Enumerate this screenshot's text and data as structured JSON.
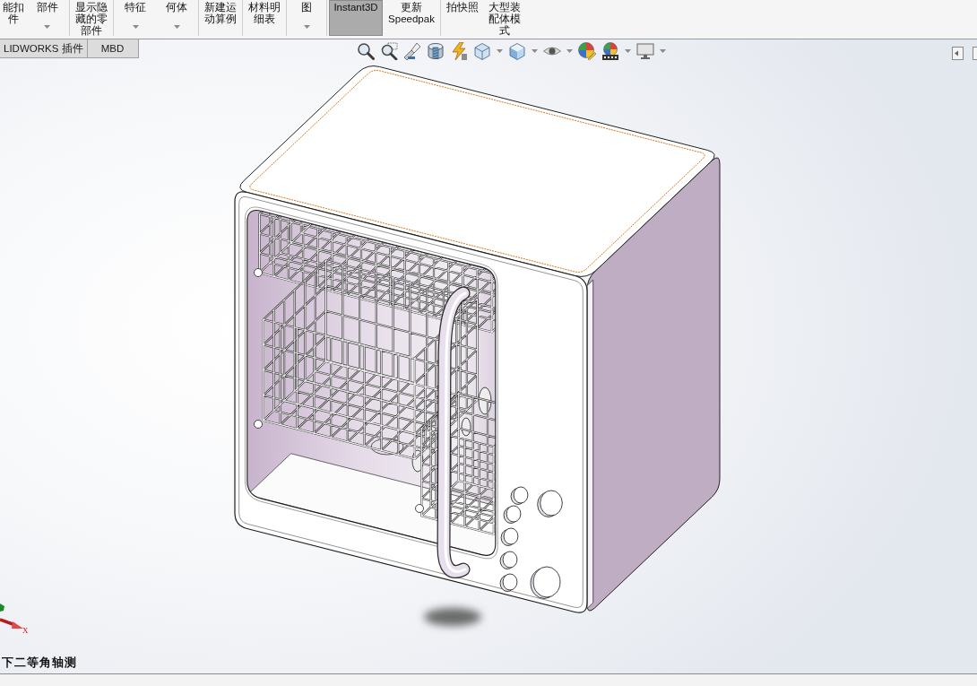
{
  "ribbon": {
    "groups": [
      {
        "buttons": [
          {
            "lines": [
              "能扣",
              "件"
            ],
            "dropdown": false,
            "on": false
          },
          {
            "lines": [
              "部件"
            ],
            "dropdown": true,
            "on": false
          }
        ]
      },
      {
        "buttons": [
          {
            "lines": [
              "显示隐",
              "藏的零",
              "部件"
            ],
            "dropdown": false,
            "on": false
          }
        ]
      },
      {
        "buttons": [
          {
            "lines": [
              "特征"
            ],
            "dropdown": true,
            "on": false
          },
          {
            "lines": [
              "何体"
            ],
            "dropdown": true,
            "on": false
          }
        ]
      },
      {
        "buttons": [
          {
            "lines": [
              "新建运",
              "动算例"
            ],
            "dropdown": false,
            "on": false
          }
        ]
      },
      {
        "buttons": [
          {
            "lines": [
              "材料明",
              "细表"
            ],
            "dropdown": false,
            "on": false
          }
        ]
      },
      {
        "buttons": [
          {
            "lines": [
              "图"
            ],
            "dropdown": true,
            "on": false
          }
        ]
      },
      {
        "buttons": [
          {
            "lines": [
              "Instant3D"
            ],
            "dropdown": false,
            "on": true
          },
          {
            "lines": [
              "更新",
              "Speedpak"
            ],
            "dropdown": false,
            "on": false
          }
        ]
      },
      {
        "buttons": [
          {
            "lines": [
              "拍快照"
            ],
            "dropdown": false,
            "on": false
          },
          {
            "lines": [
              "大型装",
              "配体模",
              "式"
            ],
            "dropdown": false,
            "on": false
          }
        ]
      }
    ]
  },
  "tabs": [
    {
      "label": "LIDWORKS 插件",
      "selected": false
    },
    {
      "label": "MBD",
      "selected": false
    }
  ],
  "triad": {
    "x_label": "X"
  },
  "view_name": "下二等角轴测"
}
